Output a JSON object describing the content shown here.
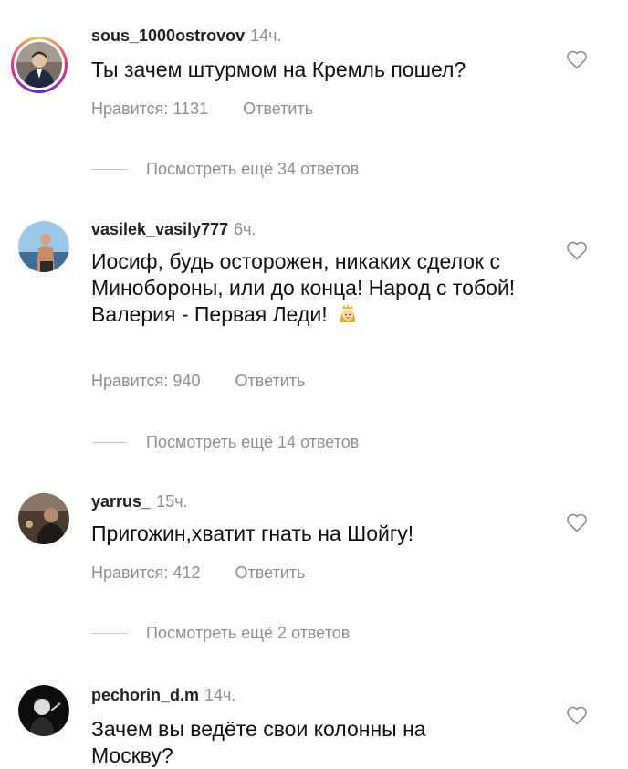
{
  "comments": [
    {
      "username": "sous_1000ostrovov",
      "time": "14ч.",
      "text": "Ты зачем штурмом на Кремль пошел?",
      "likes": "Нравится: 1131",
      "reply": "Ответить",
      "more": "Посмотреть ещё 34 ответов"
    },
    {
      "username": "vasilek_vasily777",
      "time": "6ч.",
      "text": "Иосиф, будь осторожен, никаких сделок с Минобороны, или до конца! Народ с тобой! Валерия - Первая Леди!",
      "emoji": "princess-emoji",
      "likes": "Нравится: 940",
      "reply": "Ответить",
      "more": "Посмотреть ещё 14 ответов"
    },
    {
      "username": "yarrus_",
      "time": "15ч.",
      "text": "Пригожин,хватит гнать на Шойгу!",
      "likes": "Нравится: 412",
      "reply": "Ответить",
      "more": "Посмотреть ещё 2 ответов"
    },
    {
      "username": "pechorin_d.m",
      "time": "14ч.",
      "text": "Зачем вы ведёте свои колонны на Москву?"
    }
  ],
  "icons": {
    "like": "heart-outline-icon"
  },
  "colors": {
    "text": "#111111",
    "secondary": "#8e8e8e",
    "story_ring_start": "#f9ce34",
    "story_ring_end": "#6228d7"
  }
}
